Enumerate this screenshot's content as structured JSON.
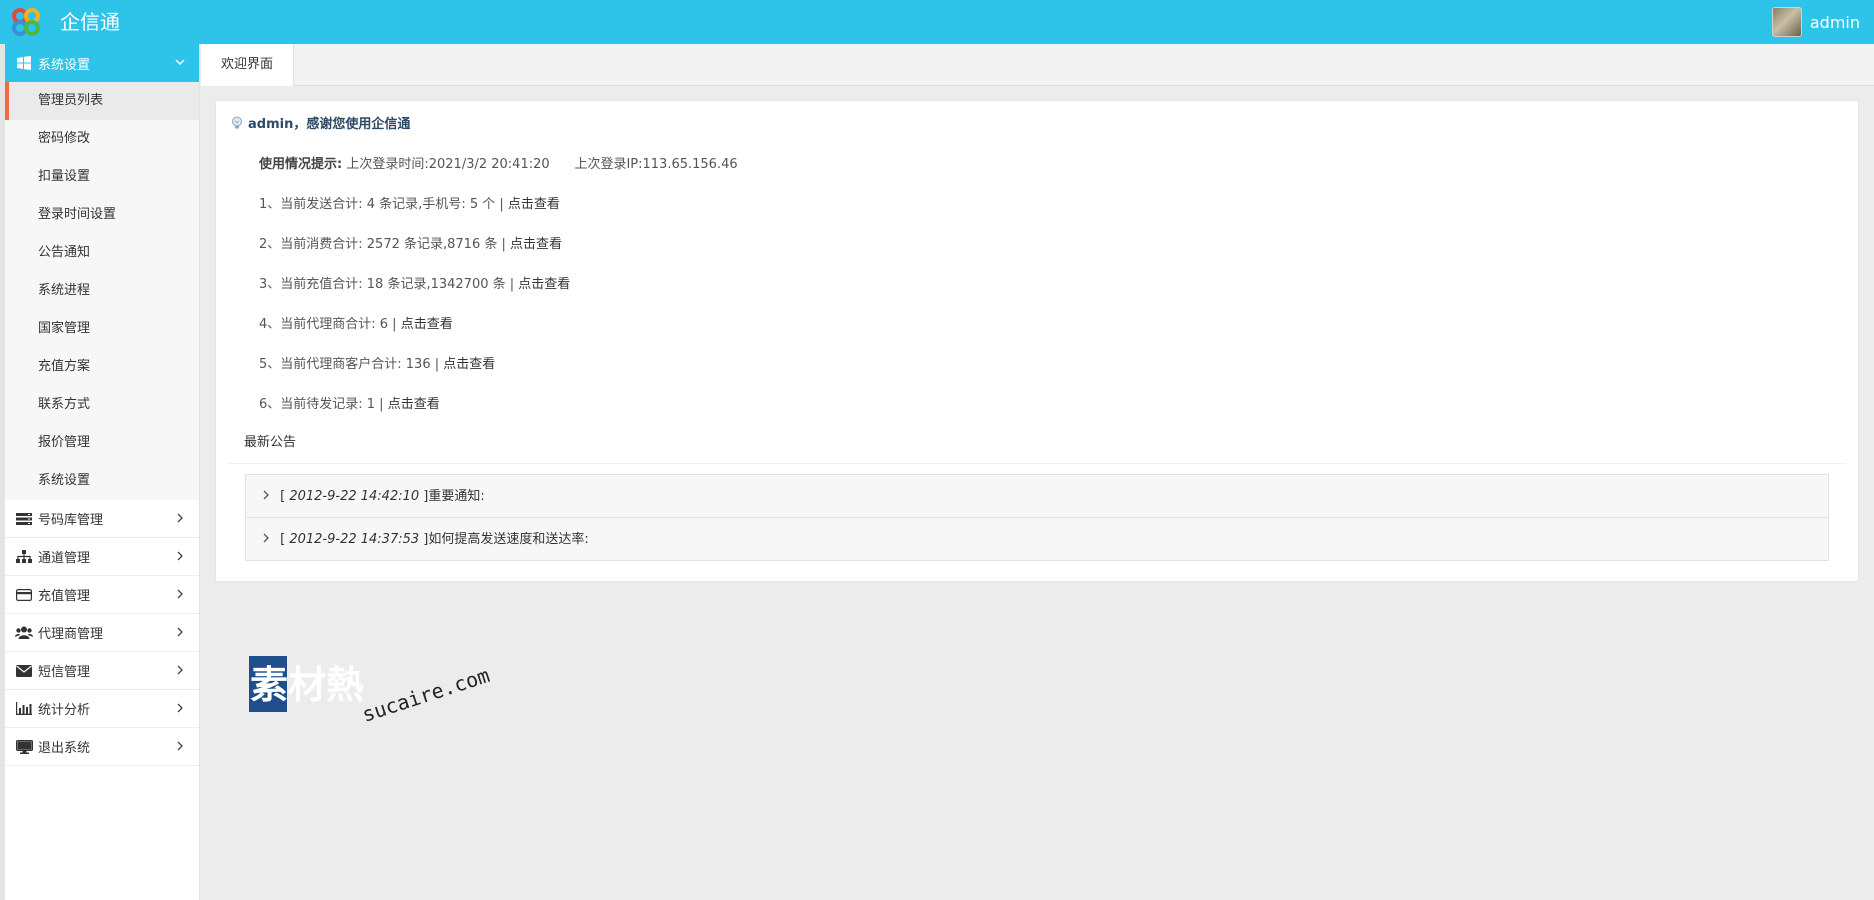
{
  "header": {
    "title": "企信通",
    "user": "admin"
  },
  "sidebar": {
    "active_group": {
      "label": "系统设置",
      "icon": "windows-icon"
    },
    "sub_items": [
      {
        "label": "管理员列表"
      },
      {
        "label": "密码修改"
      },
      {
        "label": "扣量设置"
      },
      {
        "label": "登录时间设置"
      },
      {
        "label": "公告通知"
      },
      {
        "label": "系统进程"
      },
      {
        "label": "国家管理"
      },
      {
        "label": "充值方案"
      },
      {
        "label": "联系方式"
      },
      {
        "label": "报价管理"
      },
      {
        "label": "系统设置"
      }
    ],
    "groups": [
      {
        "label": "号码库管理",
        "icon": "server-icon"
      },
      {
        "label": "通道管理",
        "icon": "sitemap-icon"
      },
      {
        "label": "充值管理",
        "icon": "credit-card-icon"
      },
      {
        "label": "代理商管理",
        "icon": "users-icon"
      },
      {
        "label": "短信管理",
        "icon": "envelope-icon"
      },
      {
        "label": "统计分析",
        "icon": "bar-chart-icon"
      },
      {
        "label": "退出系统",
        "icon": "monitor-icon"
      }
    ]
  },
  "tabs": [
    {
      "label": "欢迎界面"
    }
  ],
  "main": {
    "welcome": "admin，感谢您使用企信通",
    "usage_label": "使用情况提示:",
    "last_login_time_label": "上次登录时间:",
    "last_login_time": "2021/3/2 20:41:20",
    "last_login_ip_label": "上次登录IP:",
    "last_login_ip": "113.65.156.46",
    "stats": [
      {
        "text": "1、当前发送合计: 4 条记录,手机号: 5 个 |",
        "link": "点击查看"
      },
      {
        "text": "2、当前消费合计: 2572 条记录,8716 条 |",
        "link": "点击查看"
      },
      {
        "text": "3、当前充值合计: 18 条记录,1342700 条 |",
        "link": "点击查看"
      },
      {
        "text": "4、当前代理商合计: 6 |",
        "link": "点击查看"
      },
      {
        "text": "5、当前代理商客户合计: 136 |",
        "link": "点击查看"
      },
      {
        "text": "6、当前待发记录: 1 |",
        "link": "点击查看"
      }
    ],
    "notice_title": "最新公告",
    "notices": [
      {
        "date": "2012-9-22 14:42:10",
        "title": "重要通知:"
      },
      {
        "date": "2012-9-22 14:37:53",
        "title": "如何提高发送速度和送达率:"
      }
    ]
  },
  "watermark": {
    "cn": "素材熱",
    "en": "sucaire.com"
  }
}
